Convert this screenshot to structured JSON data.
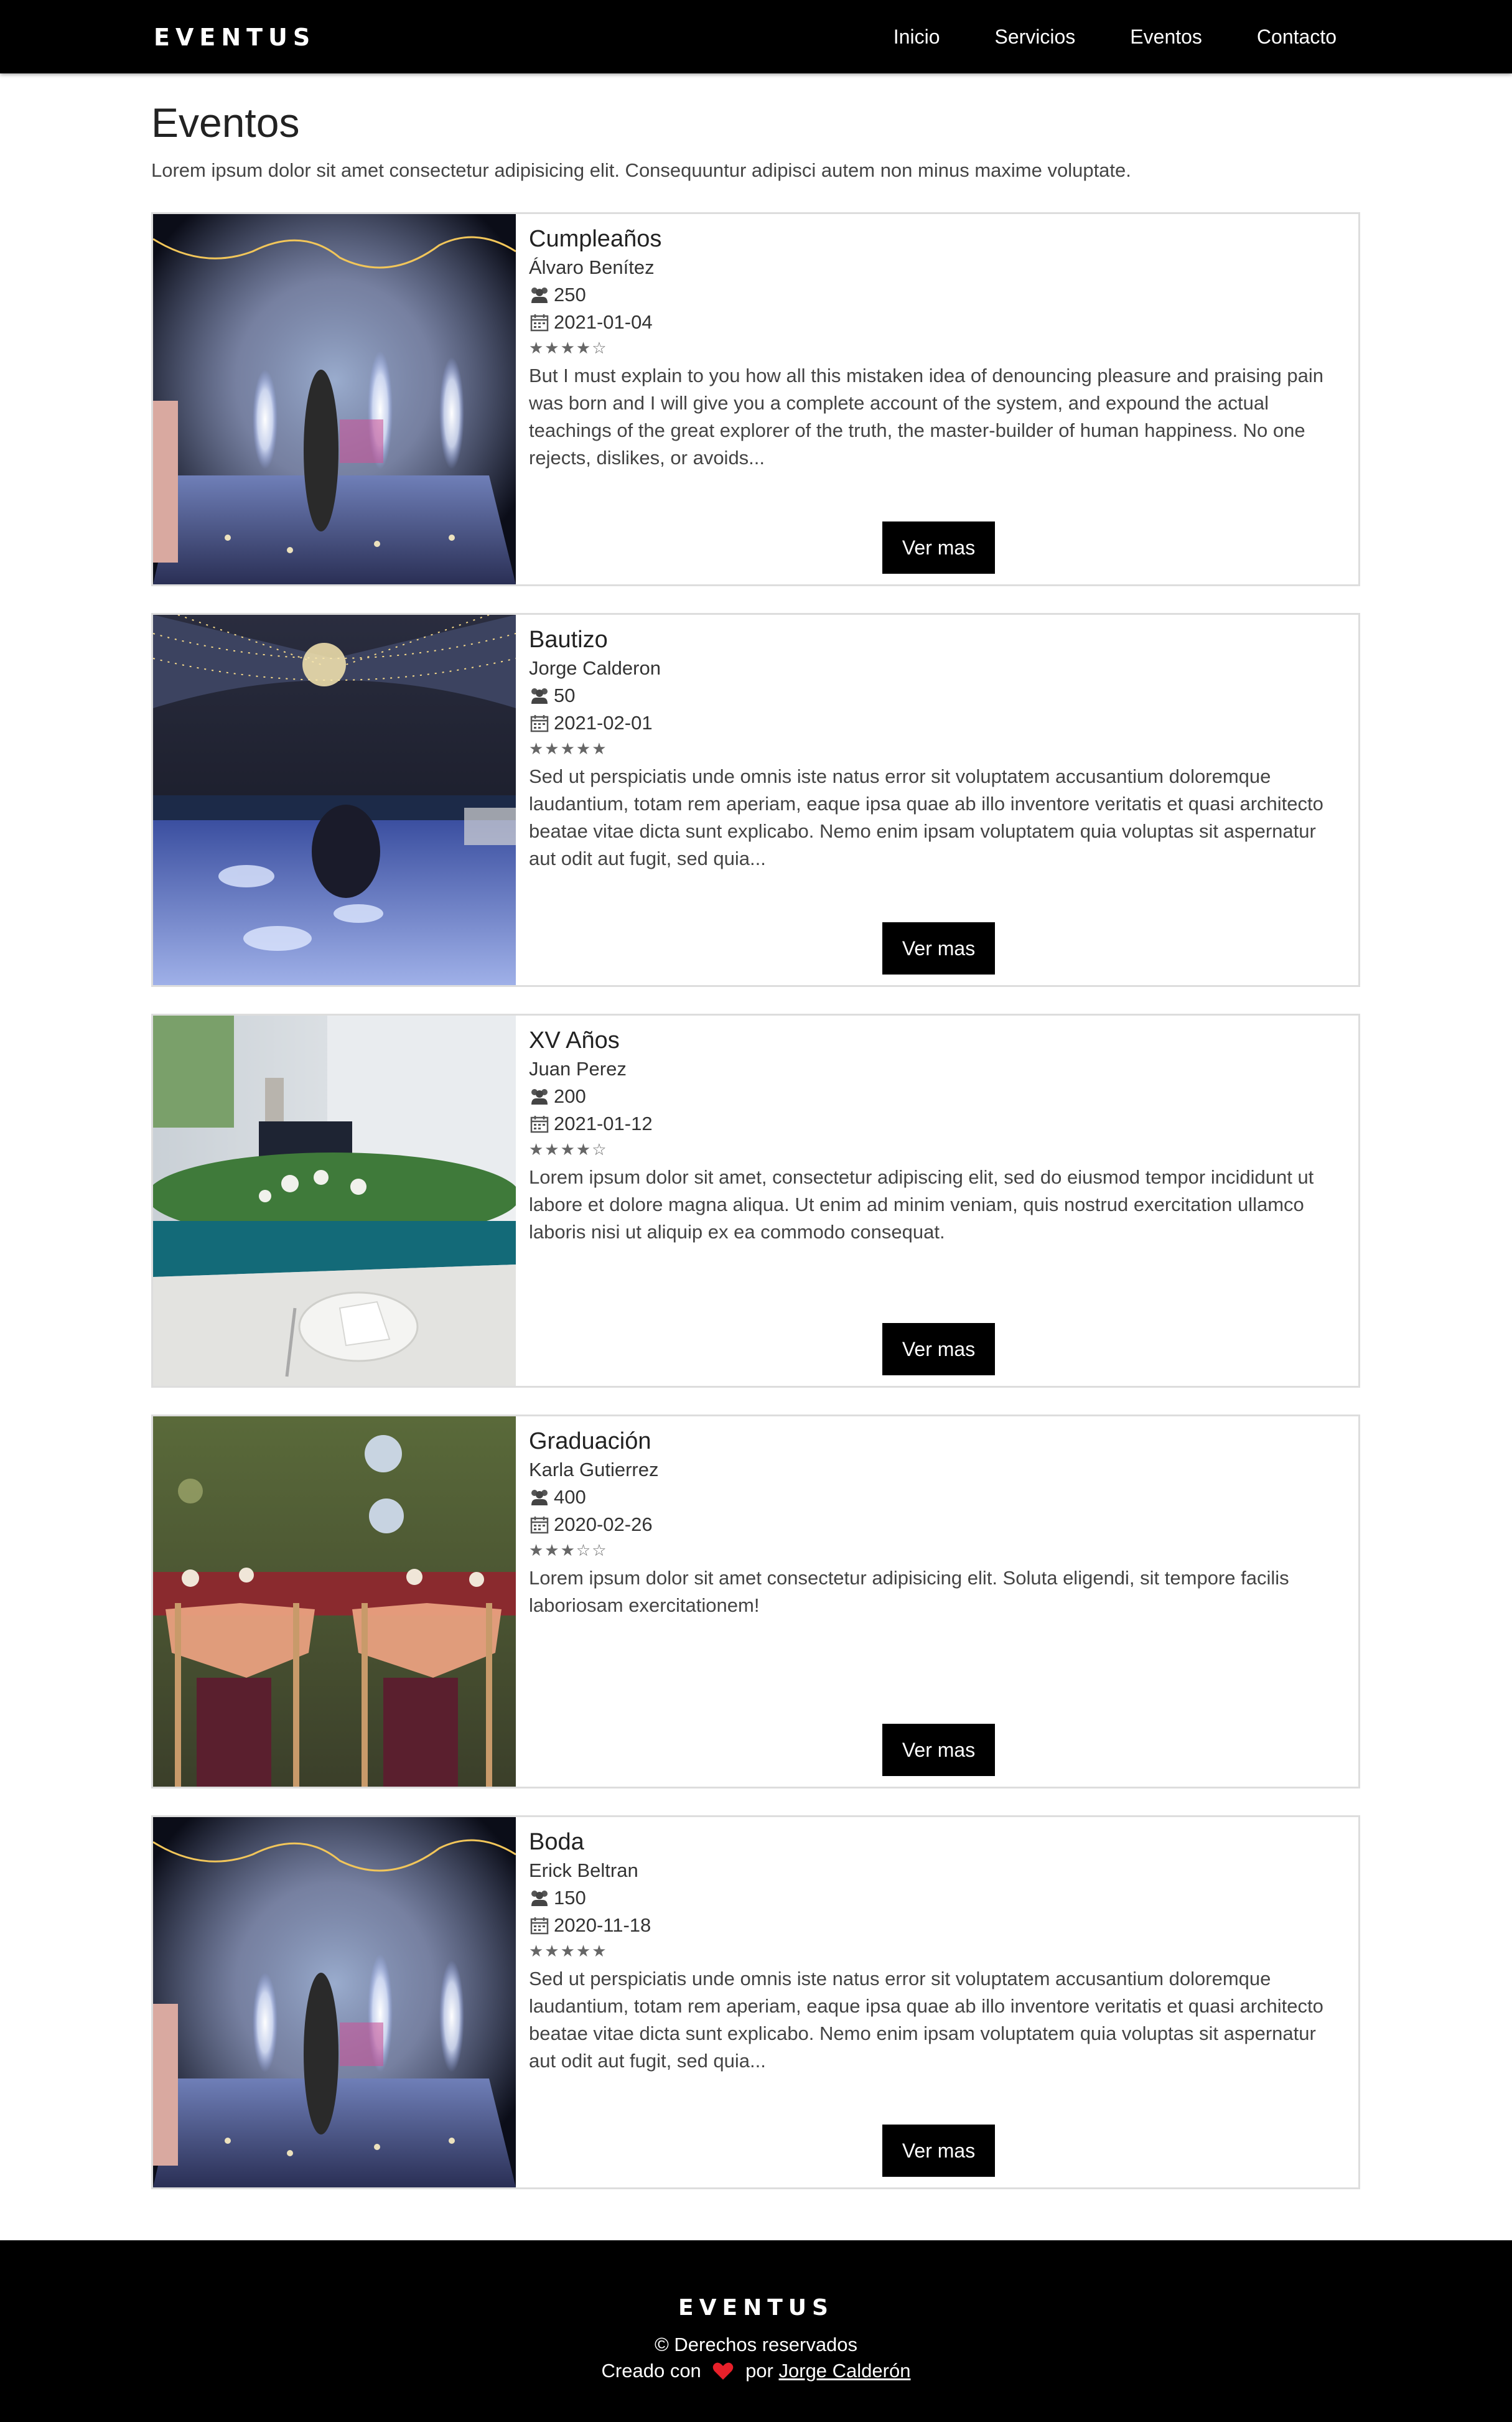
{
  "navbar": {
    "brand": "EVENTUS",
    "links": [
      "Inicio",
      "Servicios",
      "Eventos",
      "Contacto"
    ]
  },
  "header": {
    "title": "Eventos",
    "intro": "Lorem ipsum dolor sit amet consectetur adipisicing elit. Consequuntur adipisci autem non minus maxime voluptate."
  },
  "events": [
    {
      "title": "Cumpleaños",
      "author": "Álvaro Benítez",
      "guests": "250",
      "date": "2021-01-04",
      "rating": 4,
      "stars": "★★★★☆",
      "description": "But I must explain to you how all this mistaken idea of denouncing pleasure and praising pain was born and I will give you a complete account of the system, and expound the actual teachings of the great explorer of the truth, the master-builder of human happiness. No one rejects, dislikes, or avoids...",
      "button": "Ver mas",
      "image": "party-sparklers-photo"
    },
    {
      "title": "Bautizo",
      "author": "Jorge Calderon",
      "guests": "50",
      "date": "2021-02-01",
      "rating": 5,
      "stars": "★★★★★",
      "description": "Sed ut perspiciatis unde omnis iste natus error sit voluptatem accusantium doloremque laudantium, totam rem aperiam, eaque ipsa quae ab illo inventore veritatis et quasi architecto beatae vitae dicta sunt explicabo. Nemo enim ipsam voluptatem quia voluptas sit aspernatur aut odit aut fugit, sed quia...",
      "button": "Ver mas",
      "image": "tent-dance-floor-photo"
    },
    {
      "title": "XV Años",
      "author": "Juan Perez",
      "guests": "200",
      "date": "2021-01-12",
      "rating": 4,
      "stars": "★★★★☆",
      "description": "Lorem ipsum dolor sit amet, consectetur adipiscing elit, sed do eiusmod tempor incididunt ut labore et dolore magna aliqua. Ut enim ad minim veniam, quis nostrud exercitation ullamco laboris nisi ut aliquip ex ea commodo consequat.",
      "button": "Ver mas",
      "image": "table-centerpiece-photo"
    },
    {
      "title": "Graduación",
      "author": "Karla Gutierrez",
      "guests": "400",
      "date": "2020-02-26",
      "rating": 3,
      "stars": "★★★☆☆",
      "description": "Lorem ipsum dolor sit amet consectetur adipisicing elit. Soluta eligendi, sit tempore facilis laboriosam exercitationem!",
      "button": "Ver mas",
      "image": "mrs-mr-chairs-photo"
    },
    {
      "title": "Boda",
      "author": "Erick Beltran",
      "guests": "150",
      "date": "2020-11-18",
      "rating": 5,
      "stars": "★★★★★",
      "description": "Sed ut perspiciatis unde omnis iste natus error sit voluptatem accusantium doloremque laudantium, totam rem aperiam, eaque ipsa quae ab illo inventore veritatis et quasi architecto beatae vitae dicta sunt explicabo. Nemo enim ipsam voluptatem quia voluptas sit aspernatur aut odit aut fugit, sed quia...",
      "button": "Ver mas",
      "image": "party-sparklers-photo"
    }
  ],
  "footer": {
    "brand": "EVENTUS",
    "rights": "© Derechos reservados",
    "created_with": "Creado con",
    "by": "por",
    "author": "Jorge Calderón",
    "heart_color": "#e8202a"
  },
  "colors": {
    "nav_bg": "#000000",
    "footer_bg": "#000000",
    "button_bg": "#000000",
    "card_border": "#dddddd"
  }
}
